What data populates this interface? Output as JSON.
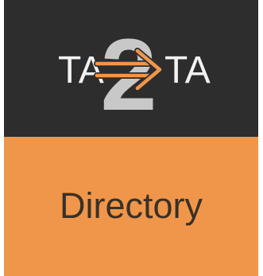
{
  "logo": {
    "left_text": "TA",
    "center_text": "2",
    "right_text": "TA",
    "icon": "arrow-right-icon"
  },
  "tile": {
    "label": "Directory"
  },
  "colors": {
    "logo_background": "#2d2d2d",
    "label_background": "#f0964a",
    "label_text": "#3a3026",
    "logo_text": "#f2f2f2",
    "digit": "#c8c8c8",
    "arrow": "#f0964a"
  }
}
